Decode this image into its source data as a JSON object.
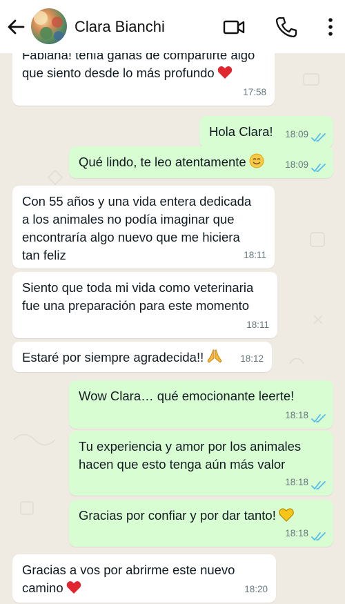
{
  "header": {
    "contact_name": "Clara Bianchi",
    "icons": [
      "back-arrow-icon",
      "video-call-icon",
      "phone-call-icon",
      "more-options-icon"
    ]
  },
  "colors": {
    "chat_background": "#efeae2",
    "incoming_bubble": "#ffffff",
    "outgoing_bubble": "#d9fdd3",
    "read_ticks": "#53bdeb",
    "heart": "#e0262f",
    "yellow_heart": "#f5c518"
  },
  "messages": [
    {
      "dir": "in",
      "text": "Fabiana! tenía ganas de compartirte algo\nque siento desde lo más profundo",
      "emoji": "red-heart",
      "time": "17:58"
    },
    {
      "dir": "out",
      "text": "Hola Clara!",
      "time": "18:09",
      "status": "read"
    },
    {
      "dir": "out",
      "text": "Qué lindo, te leo atentamente",
      "emoji": "smiling-face",
      "time": "18:09",
      "status": "read"
    },
    {
      "dir": "in",
      "text": "Con 55 años y una vida entera dedicada\na los animales no podía imaginar que\nencontraría algo nuevo que me hiciera\ntan feliz",
      "time": "18:11"
    },
    {
      "dir": "in",
      "text": "Siento que toda mi vida como veterinaria\nfue una preparación para este momento",
      "time": "18:11"
    },
    {
      "dir": "in",
      "text": "Estaré por siempre agradecida!!",
      "emoji": "folded-hands",
      "time": "18:12"
    },
    {
      "dir": "out",
      "text": "Wow Clara… qué emocionante leerte!",
      "time": "18:18",
      "status": "read"
    },
    {
      "dir": "out",
      "text": "Tu experiencia y amor por los animales\nhacen que esto tenga aún más valor",
      "time": "18:18",
      "status": "read"
    },
    {
      "dir": "out",
      "text": "Gracias por confiar y por dar tanto!",
      "emoji": "yellow-heart",
      "time": "18:18",
      "status": "read"
    },
    {
      "dir": "in",
      "text": "Gracias a vos por abrirme este nuevo\ncamino",
      "emoji": "red-heart",
      "time": "18:20"
    }
  ]
}
